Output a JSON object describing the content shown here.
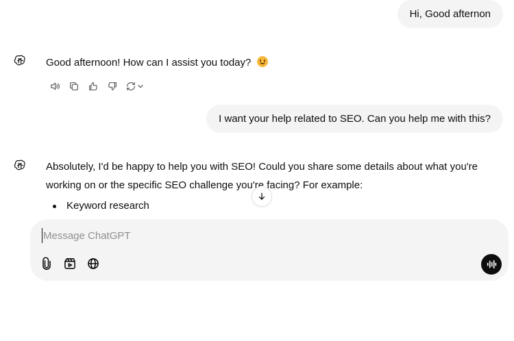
{
  "conversation": {
    "user_message_1": "Hi, Good afternon",
    "assistant_message_1": "Good afternoon! How can I assist you today?",
    "assistant_message_1_emoji": "smiling-face-emoji",
    "user_message_2": "I want your help related to SEO. Can you help me with this?",
    "assistant_message_2": "Absolutely, I'd be happy to help you with SEO! Could you share some details about what you're working on or the specific SEO challenge you're facing? For example:",
    "assistant_message_2_bullets": [
      "Keyword research"
    ]
  },
  "message_actions": {
    "icons": [
      "read-aloud-icon",
      "copy-icon",
      "thumbs-up-icon",
      "thumbs-down-icon",
      "regenerate-icon",
      "chevron-down-icon"
    ]
  },
  "composer": {
    "placeholder": "Message ChatGPT",
    "value": "",
    "tools": [
      "attach-icon",
      "tools-icon",
      "web-search-icon"
    ],
    "voice_icon": "voice-mode-icon"
  },
  "colors": {
    "bubble_bg": "#f4f4f4",
    "composer_bg": "#f4f4f4",
    "text": "#0d0d0d",
    "icon_muted": "#5d5d5d",
    "voice_bg": "#0d0d0d"
  }
}
